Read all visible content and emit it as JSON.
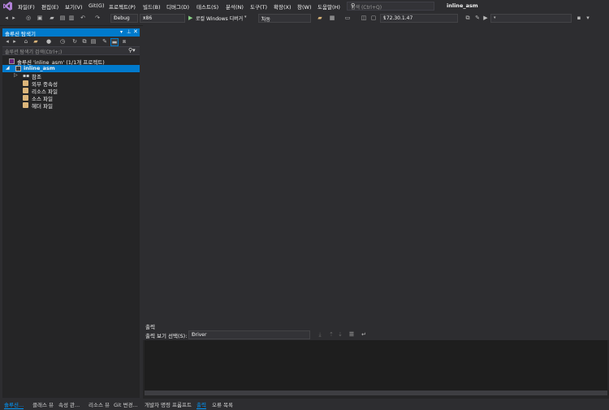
{
  "menu": [
    "파일(F)",
    "편집(E)",
    "보기(V)",
    "Git(G)",
    "프로젝트(P)",
    "빌드(B)",
    "디버그(D)",
    "테스트(S)",
    "분석(N)",
    "도구(T)",
    "확장(X)",
    "창(W)",
    "도움말(H)"
  ],
  "search": {
    "placeholder": "검색 (Ctrl+Q)"
  },
  "window_title": "inline_asm",
  "toolbar": {
    "config": "Debug",
    "platform": "x86",
    "run_label": "로컬 Windows 디버거",
    "auto": "자동",
    "ip": "172.30.1.47"
  },
  "solution_explorer": {
    "title": "솔루션 탐색기",
    "search_placeholder": "솔루션 탐색기 검색(Ctrl+;)",
    "solution": "솔루션 'inline_asm' (1/1개 프로젝트)",
    "project": "inline_asm",
    "items": [
      "참조",
      "외부 종속성",
      "리소스 파일",
      "소스 파일",
      "헤더 파일"
    ]
  },
  "output": {
    "title": "출력",
    "source_label": "출력 보기 선택(S):",
    "source_value": "Driver"
  },
  "bottom_tabs_left": [
    "솔루션...",
    "클래스 뷰",
    "속성 관...",
    "리소스 뷰",
    "Git 변경..."
  ],
  "bottom_tabs_right": [
    "개발자 명령 프롬프트",
    "출력",
    "오류 목록"
  ],
  "colors": {
    "accent": "#007acc",
    "background": "#2d2d30",
    "panel": "#252526",
    "folder": "#dcb67a"
  }
}
